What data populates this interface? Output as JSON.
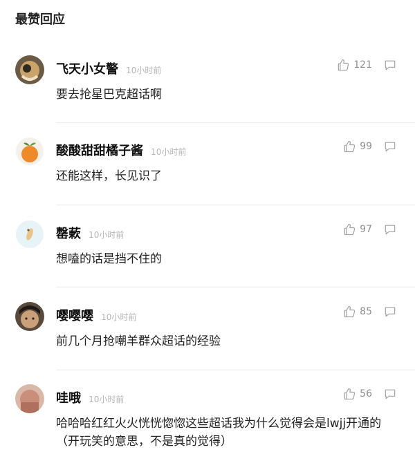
{
  "section_title": "最赞回应",
  "comments": [
    {
      "username": "飞天小女警",
      "time": "10小时前",
      "likes": "121",
      "text": "要去抢星巴克超话啊"
    },
    {
      "username": "酸酸甜甜橘子酱",
      "time": "10小时前",
      "likes": "99",
      "text": "还能这样，长见识了"
    },
    {
      "username": "罄蔌",
      "time": "10小时前",
      "likes": "97",
      "text": "想嗑的话是挡不住的"
    },
    {
      "username": "嘤嘤嘤",
      "time": "10小时前",
      "likes": "85",
      "text": "前几个月抢嘲羊群众超话的经验"
    },
    {
      "username": "哇哦",
      "time": "10小时前",
      "likes": "56",
      "text": "哈哈哈红红火火恍恍惚惚这些超话我为什么觉得会是lwjj开通的（开玩笑的意思，不是真的觉得）"
    }
  ],
  "icons": {
    "like": "thumbs-up-icon",
    "reply": "comment-bubble-icon"
  }
}
